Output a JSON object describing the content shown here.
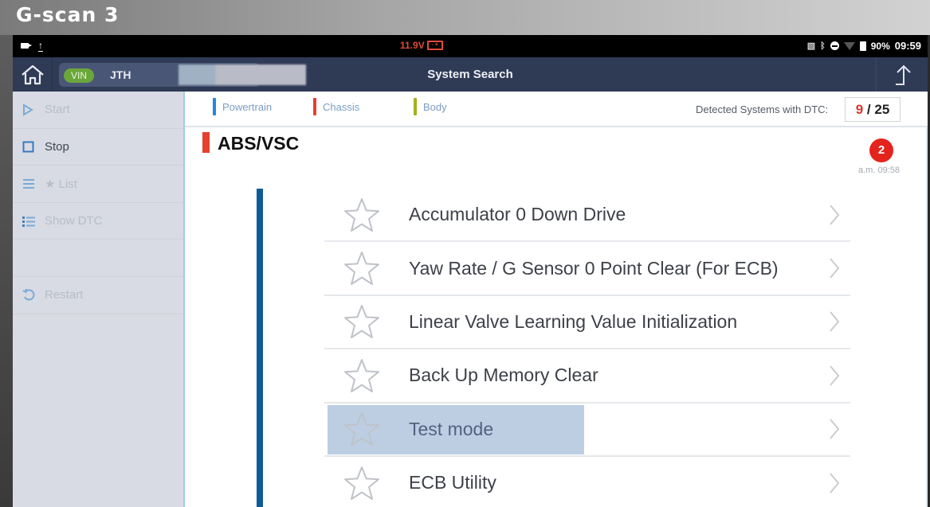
{
  "brand": {
    "logo_text": "G-scan 3"
  },
  "status_bar": {
    "voltage": "11.9V",
    "battery_percent": "90%",
    "time": "09:59",
    "icons": [
      "video-camera-icon",
      "upload-icon",
      "car-battery-icon",
      "cast-icon",
      "bluetooth-icon",
      "do-not-disturb-icon",
      "wifi-icon",
      "battery-icon"
    ]
  },
  "header": {
    "title": "System Search",
    "vin_label": "VIN",
    "vin_value": "JTH",
    "home_icon": "home-icon",
    "upload_icon": "arrow-up-icon"
  },
  "sidebar": {
    "items": [
      {
        "label": "Start",
        "icon": "play-icon",
        "enabled": false
      },
      {
        "label": "Stop",
        "icon": "stop-icon",
        "enabled": true
      },
      {
        "label": "★ List",
        "icon": "list-icon",
        "enabled": false
      },
      {
        "label": "Show DTC",
        "icon": "bullet-list-icon",
        "enabled": false
      },
      {
        "label": "Restart",
        "icon": "restart-icon",
        "enabled": false
      }
    ]
  },
  "filter_bar": {
    "legend": [
      {
        "label": "Powertrain",
        "color": "#2288e0"
      },
      {
        "label": "Chassis",
        "color": "#e6402f"
      },
      {
        "label": "Body",
        "color": "#a3b219"
      }
    ],
    "dtc_label": "Detected Systems with DTC:",
    "dtc_detected": "9",
    "dtc_separator": " / ",
    "dtc_total": "25"
  },
  "system": {
    "name": "ABS/VSC",
    "category_color": "#e6402f",
    "dtc_badge": "2",
    "badge_time": "a.m. 09:58"
  },
  "functions": [
    {
      "label": "Accumulator 0 Down Drive",
      "favorite": false,
      "selected": false
    },
    {
      "label": "Yaw Rate / G Sensor 0 Point Clear (For ECB)",
      "favorite": false,
      "selected": false
    },
    {
      "label": "Linear Valve Learning Value Initialization",
      "favorite": false,
      "selected": false
    },
    {
      "label": "Back Up Memory Clear",
      "favorite": false,
      "selected": false
    },
    {
      "label": "Test mode",
      "favorite": false,
      "selected": true
    },
    {
      "label": "ECB Utility",
      "favorite": false,
      "selected": false
    }
  ],
  "colors": {
    "header_bg": "#2f3a55",
    "accent_blue": "#0c5c99",
    "selection": "#bdcee3",
    "alert_red": "#e4231d"
  }
}
